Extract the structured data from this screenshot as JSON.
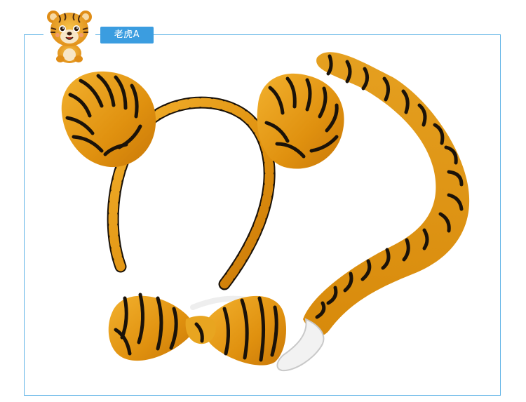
{
  "label": {
    "text": "老虎A"
  },
  "colors": {
    "accent": "#3b9de0",
    "frame": "#5fb3e6",
    "fur": "#e39a10",
    "stripe": "#1a1209"
  },
  "icons": {
    "mascot": "tiger-cartoon-icon"
  }
}
